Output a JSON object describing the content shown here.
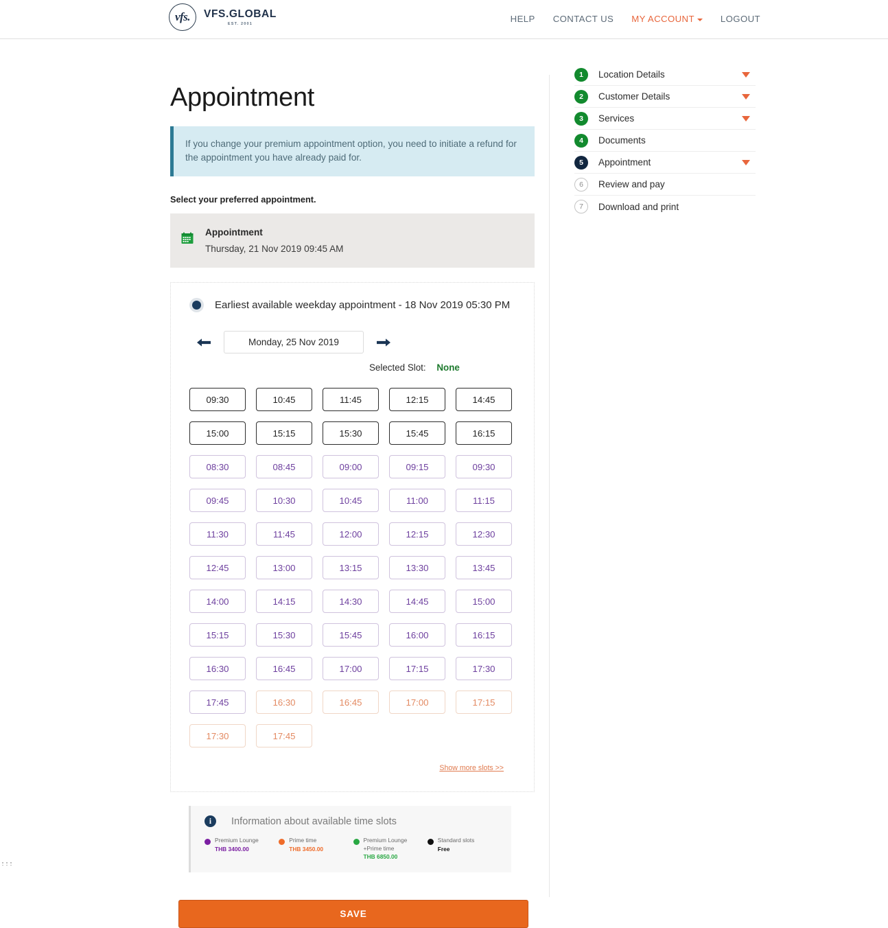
{
  "header": {
    "logo_mark": "vfs.",
    "logo_name": "VFS.GLOBAL",
    "logo_est": "EST. 2001",
    "nav": [
      {
        "label": "HELP",
        "active": false
      },
      {
        "label": "CONTACT US",
        "active": false
      },
      {
        "label": "MY ACCOUNT",
        "active": true
      },
      {
        "label": "LOGOUT",
        "active": false
      }
    ]
  },
  "main": {
    "page_title": "Appointment",
    "alert": "If you change your premium appointment option, you need to initiate a refund for the appointment you have already paid for.",
    "select_preferred": "Select your preferred appointment.",
    "appointment_card": {
      "icon": "calendar-icon",
      "label": "Appointment",
      "datetime": "Thursday, 21 Nov 2019 09:45 AM"
    },
    "radio_option": {
      "label": "Earliest available weekday appointment - 18 Nov 2019 05:30 PM",
      "selected": true
    },
    "date_nav": {
      "prev_icon": "arrow-left-icon",
      "next_icon": "arrow-right-icon",
      "current_date": "Monday, 25 Nov 2019"
    },
    "selected_slot": {
      "label": "Selected Slot:",
      "value": "None"
    },
    "slots": [
      {
        "time": "09:30",
        "type": "standard"
      },
      {
        "time": "10:45",
        "type": "standard"
      },
      {
        "time": "11:45",
        "type": "standard"
      },
      {
        "time": "12:15",
        "type": "standard"
      },
      {
        "time": "14:45",
        "type": "standard"
      },
      {
        "time": "15:00",
        "type": "standard"
      },
      {
        "time": "15:15",
        "type": "standard"
      },
      {
        "time": "15:30",
        "type": "standard"
      },
      {
        "time": "15:45",
        "type": "standard"
      },
      {
        "time": "16:15",
        "type": "standard"
      },
      {
        "time": "08:30",
        "type": "premium"
      },
      {
        "time": "08:45",
        "type": "premium"
      },
      {
        "time": "09:00",
        "type": "premium"
      },
      {
        "time": "09:15",
        "type": "premium"
      },
      {
        "time": "09:30",
        "type": "premium"
      },
      {
        "time": "09:45",
        "type": "premium"
      },
      {
        "time": "10:30",
        "type": "premium"
      },
      {
        "time": "10:45",
        "type": "premium"
      },
      {
        "time": "11:00",
        "type": "premium"
      },
      {
        "time": "11:15",
        "type": "premium"
      },
      {
        "time": "11:30",
        "type": "premium"
      },
      {
        "time": "11:45",
        "type": "premium"
      },
      {
        "time": "12:00",
        "type": "premium"
      },
      {
        "time": "12:15",
        "type": "premium"
      },
      {
        "time": "12:30",
        "type": "premium"
      },
      {
        "time": "12:45",
        "type": "premium"
      },
      {
        "time": "13:00",
        "type": "premium"
      },
      {
        "time": "13:15",
        "type": "premium"
      },
      {
        "time": "13:30",
        "type": "premium"
      },
      {
        "time": "13:45",
        "type": "premium"
      },
      {
        "time": "14:00",
        "type": "premium"
      },
      {
        "time": "14:15",
        "type": "premium"
      },
      {
        "time": "14:30",
        "type": "premium"
      },
      {
        "time": "14:45",
        "type": "premium"
      },
      {
        "time": "15:00",
        "type": "premium"
      },
      {
        "time": "15:15",
        "type": "premium"
      },
      {
        "time": "15:30",
        "type": "premium"
      },
      {
        "time": "15:45",
        "type": "premium"
      },
      {
        "time": "16:00",
        "type": "premium"
      },
      {
        "time": "16:15",
        "type": "premium"
      },
      {
        "time": "16:30",
        "type": "premium"
      },
      {
        "time": "16:45",
        "type": "premium"
      },
      {
        "time": "17:00",
        "type": "premium"
      },
      {
        "time": "17:15",
        "type": "premium"
      },
      {
        "time": "17:30",
        "type": "premium"
      },
      {
        "time": "17:45",
        "type": "premium"
      },
      {
        "time": "16:30",
        "type": "prime"
      },
      {
        "time": "16:45",
        "type": "prime"
      },
      {
        "time": "17:00",
        "type": "prime"
      },
      {
        "time": "17:15",
        "type": "prime"
      },
      {
        "time": "17:30",
        "type": "prime"
      },
      {
        "time": "17:45",
        "type": "prime"
      }
    ],
    "show_more": "Show more slots >>",
    "legend": {
      "icon": "info-icon",
      "title": "Information about available time slots",
      "items": [
        {
          "name": "Premium Lounge",
          "price": "THB 3400.00",
          "color": "#7b1fa2"
        },
        {
          "name": "Prime time",
          "price": "THB 3450.00",
          "color": "#ef6c2a"
        },
        {
          "name": "Premium Lounge\n+Prime time",
          "price": "THB 6850.00",
          "color": "#29a843"
        },
        {
          "name": "Standard slots",
          "price": "Free",
          "color": "#111111"
        }
      ]
    },
    "save_label": "SAVE"
  },
  "sidebar": {
    "steps": [
      {
        "num": "1",
        "label": "Location Details",
        "state": "done",
        "caret": true
      },
      {
        "num": "2",
        "label": "Customer Details",
        "state": "done",
        "caret": true
      },
      {
        "num": "3",
        "label": "Services",
        "state": "done",
        "caret": true
      },
      {
        "num": "4",
        "label": "Documents",
        "state": "done",
        "caret": false
      },
      {
        "num": "5",
        "label": "Appointment",
        "state": "active",
        "caret": true
      },
      {
        "num": "6",
        "label": "Review and pay",
        "state": "todo",
        "caret": false
      },
      {
        "num": "7",
        "label": "Download and print",
        "state": "todo",
        "caret": false
      }
    ]
  },
  "colors": {
    "accent_orange": "#e8671e",
    "premium_purple": "#6d3f9e",
    "prime_orange": "#e38a62",
    "standard_black": "#232323",
    "step_green": "#128a2e",
    "step_active_navy": "#11263f"
  }
}
